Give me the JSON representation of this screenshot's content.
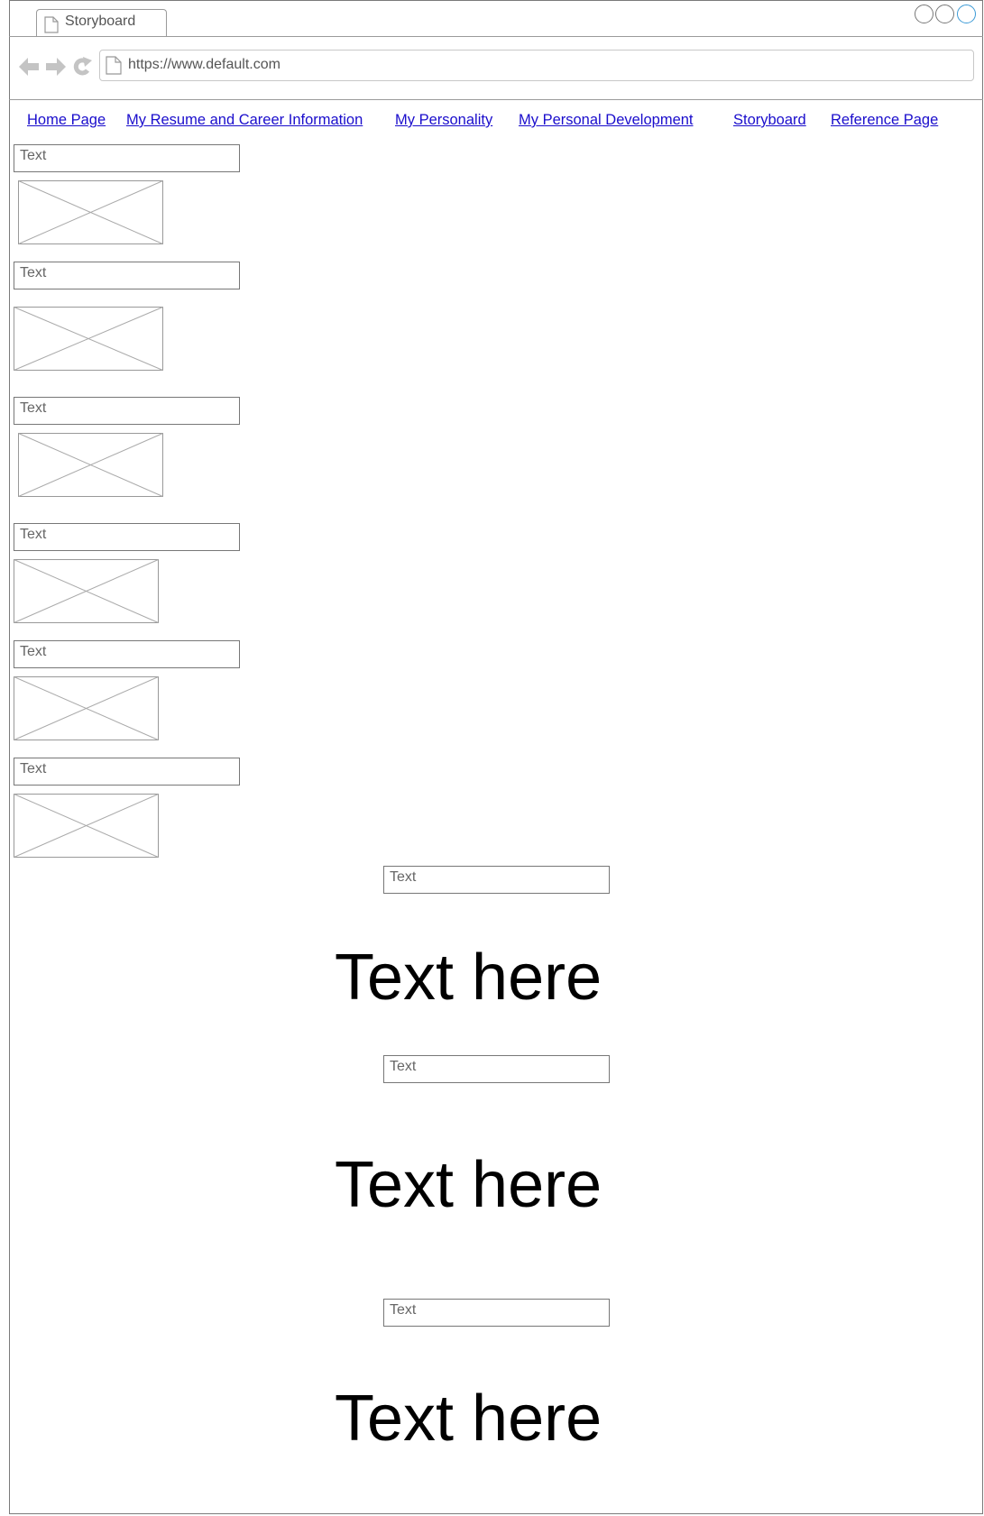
{
  "browser": {
    "tab_title": "Storyboard",
    "url": "https://www.default.com"
  },
  "nav": {
    "links": [
      "Home Page",
      "My Resume and Career Information",
      "My Personality",
      "My Personal Development",
      "Storyboard",
      "Reference Page"
    ]
  },
  "sidebar": {
    "items": [
      {
        "text": "Text"
      },
      {
        "text": "Text"
      },
      {
        "text": "Text"
      },
      {
        "text": "Text"
      },
      {
        "text": "Text"
      },
      {
        "text": "Text"
      }
    ]
  },
  "main": {
    "sections": [
      {
        "label": "Text",
        "heading": "Text here"
      },
      {
        "label": "Text",
        "heading": "Text here"
      },
      {
        "label": "Text",
        "heading": "Text here"
      }
    ]
  },
  "colors": {
    "link": "#1a0dcc",
    "active_window_control": "#3b9ad6"
  },
  "icons": [
    "page-icon",
    "back-arrow-icon",
    "forward-arrow-icon",
    "reload-icon",
    "window-control-icon",
    "image-placeholder-icon"
  ]
}
